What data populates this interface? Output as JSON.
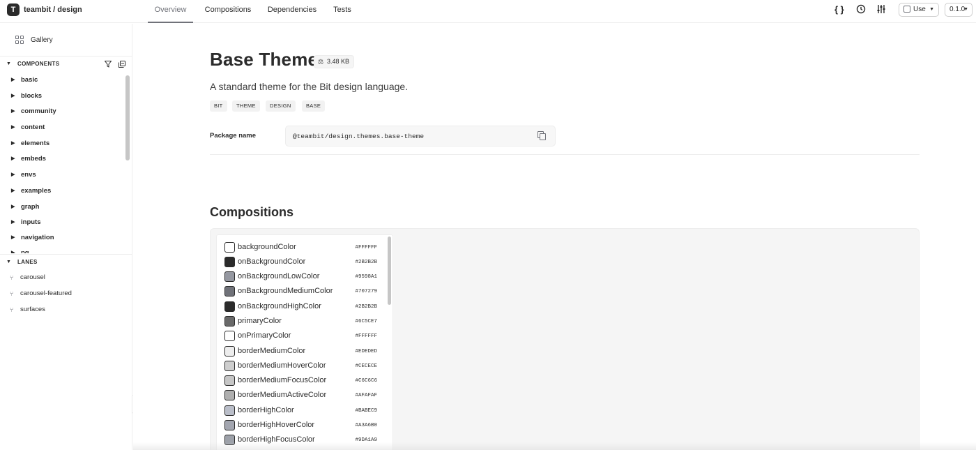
{
  "header": {
    "logo_glyph": "T",
    "scope_name": "teambit / design",
    "tabs": [
      {
        "label": "Overview",
        "active": true
      },
      {
        "label": "Compositions",
        "active": false
      },
      {
        "label": "Dependencies",
        "active": false
      },
      {
        "label": "Tests",
        "active": false
      }
    ],
    "icons": [
      "code-icon",
      "history-icon",
      "settings-sliders-icon"
    ],
    "use_button": {
      "label": "Use",
      "icon": "package-icon"
    },
    "version_select": {
      "value": "0.1.0"
    }
  },
  "sidebar": {
    "gallery_label": "Gallery",
    "components_header": "COMPONENTS",
    "components": [
      "basic",
      "blocks",
      "community",
      "content",
      "elements",
      "embeds",
      "envs",
      "examples",
      "graph",
      "inputs",
      "navigation",
      "pg"
    ],
    "lanes_header": "LANES",
    "lanes": [
      "carousel",
      "carousel-featured",
      "surfaces"
    ]
  },
  "component": {
    "title": "Base Theme",
    "size": "3.48 KB",
    "description": "A standard theme for the Bit design language.",
    "tags": [
      "BIT",
      "THEME",
      "DESIGN",
      "BASE"
    ],
    "package_label": "Package name",
    "package_name": "@teambit/design.themes.base-theme"
  },
  "compositions": {
    "title": "Compositions",
    "colors": [
      {
        "name": "backgroundColor",
        "hex": "#FFFFFF"
      },
      {
        "name": "onBackgroundColor",
        "hex": "#2B2B2B"
      },
      {
        "name": "onBackgroundLowColor",
        "hex": "#9598A1"
      },
      {
        "name": "onBackgroundMediumColor",
        "hex": "#707279"
      },
      {
        "name": "onBackgroundHighColor",
        "hex": "#2B2B2B"
      },
      {
        "name": "primaryColor",
        "hex": "#6C5CE7"
      },
      {
        "name": "onPrimaryColor",
        "hex": "#FFFFFF"
      },
      {
        "name": "borderMediumColor",
        "hex": "#EDEDED"
      },
      {
        "name": "borderMediumHoverColor",
        "hex": "#CECECE"
      },
      {
        "name": "borderMediumFocusColor",
        "hex": "#C6C6C6"
      },
      {
        "name": "borderMediumActiveColor",
        "hex": "#AFAFAF"
      },
      {
        "name": "borderHighColor",
        "hex": "#BABEC9"
      },
      {
        "name": "borderHighHoverColor",
        "hex": "#A3A6B0"
      },
      {
        "name": "borderHighFocusColor",
        "hex": "#9DA1A9"
      }
    ]
  }
}
